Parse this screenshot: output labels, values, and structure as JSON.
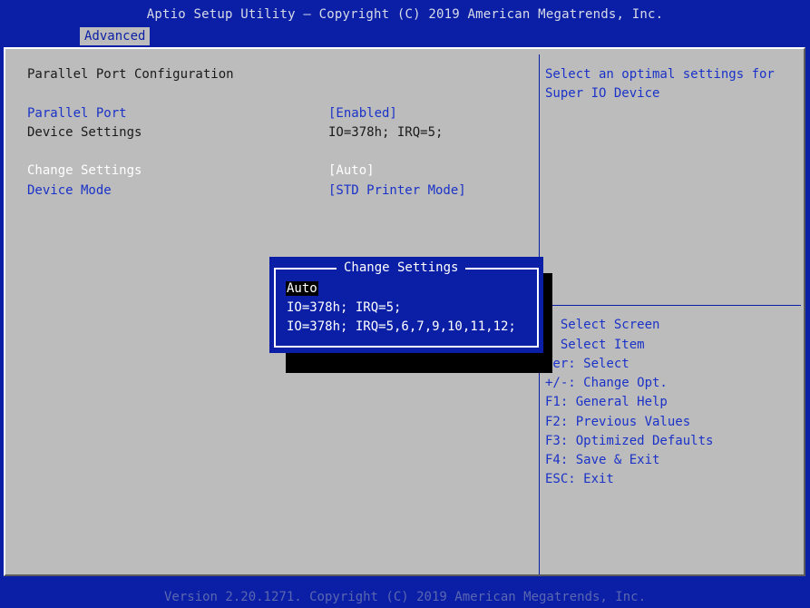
{
  "header": {
    "title": "Aptio Setup Utility – Copyright (C) 2019 American Megatrends, Inc.",
    "active_tab": "Advanced"
  },
  "main": {
    "section_title": "Parallel Port Configuration",
    "settings": [
      {
        "label": "Parallel Port",
        "value": "[Enabled]"
      },
      {
        "label": "Device Settings",
        "value": "IO=378h; IRQ=5;"
      },
      {
        "label": "Change Settings",
        "value": "[Auto]"
      },
      {
        "label": "Device Mode",
        "value": "[STD Printer Mode]"
      }
    ]
  },
  "help": {
    "description_line1": "Select an optimal settings for",
    "description_line2": "Super IO Device",
    "keys": [
      ": Select Screen",
      ": Select Item",
      "ter: Select",
      "+/-: Change Opt.",
      "F1: General Help",
      "F2: Previous Values",
      "F3: Optimized Defaults",
      "F4: Save & Exit",
      "ESC: Exit"
    ]
  },
  "dialog": {
    "title": "Change Settings",
    "options": [
      "Auto",
      "IO=378h; IRQ=5;",
      "IO=378h; IRQ=5,6,7,9,10,11,12;"
    ],
    "selected": "Auto"
  },
  "footer": {
    "version": "Version 2.20.1271. Copyright (C) 2019 American Megatrends, Inc."
  },
  "colors": {
    "background_blue": "#0a1fa5",
    "panel_gray": "#bcbcbc",
    "setting_blue": "#1a32c8",
    "highlight_white": "#ffffff"
  }
}
